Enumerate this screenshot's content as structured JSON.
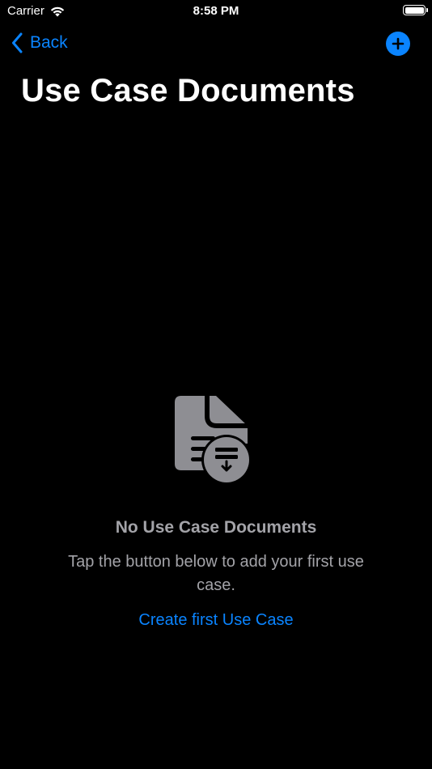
{
  "status_bar": {
    "carrier": "Carrier",
    "time": "8:58 PM",
    "wifi_icon": "wifi-icon",
    "battery_icon": "battery-full-icon"
  },
  "nav": {
    "back_label": "Back",
    "back_icon": "chevron-left-icon",
    "add_icon": "plus-circle-icon"
  },
  "page": {
    "title": "Use Case Documents"
  },
  "empty_state": {
    "icon": "document-download-icon",
    "title": "No Use Case Documents",
    "message": "Tap the button below to add your first use case.",
    "action_label": "Create first Use Case"
  },
  "colors": {
    "background": "#000000",
    "accent": "#0a84ff",
    "secondary_text": "#a3a3a8",
    "icon_gray": "#8e8e93"
  }
}
